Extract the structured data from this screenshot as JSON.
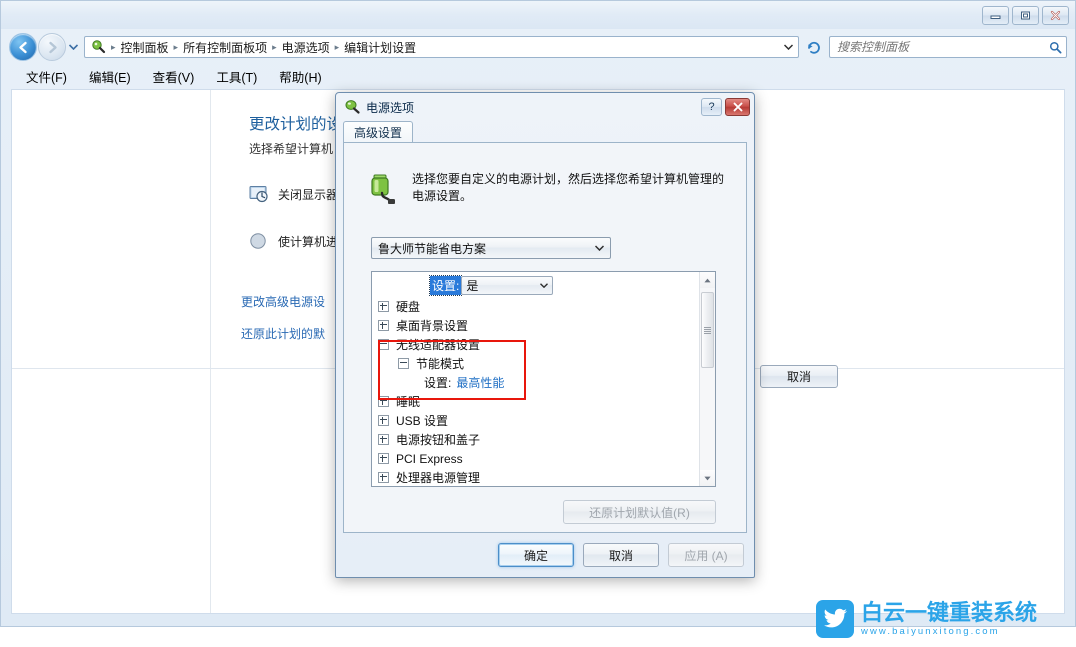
{
  "window": {
    "controls": {
      "minimize": "minimize-icon",
      "maximize": "maximize-icon",
      "close": "close-icon"
    }
  },
  "nav": {
    "back": "back-arrow-icon",
    "forward": "forward-arrow-icon",
    "history_dropdown": "chevron-down-icon",
    "refresh": "refresh-icon",
    "breadcrumb": [
      "控制面板",
      "所有控制面板项",
      "电源选项",
      "编辑计划设置"
    ],
    "breadcrumb_chevron": "chevron-down-icon"
  },
  "search": {
    "placeholder": "搜索控制面板",
    "value": "",
    "icon": "search-icon"
  },
  "menubar": {
    "items": [
      {
        "label": "文件(F)"
      },
      {
        "label": "编辑(E)"
      },
      {
        "label": "查看(V)"
      },
      {
        "label": "工具(T)"
      },
      {
        "label": "帮助(H)"
      }
    ]
  },
  "page": {
    "heading": "更改计划的设置",
    "subtitle": "选择希望计算机",
    "settings": [
      {
        "icon": "monitor-clock-icon",
        "label": "关闭显示器"
      },
      {
        "icon": "moon-sleep-icon",
        "label": "使计算机进"
      }
    ],
    "link_advanced": "更改高级电源设",
    "link_restore": "还原此计划的默",
    "cancel_button": "取消"
  },
  "dialog": {
    "title": "电源选项",
    "icon": "power-plug-icon",
    "help_button": "?",
    "close_button": "close-icon",
    "tab": "高级设置",
    "description": "选择您要自定义的电源计划，然后选择您希望计算机管理的电源设置。",
    "description_icon": "battery-plug-icon",
    "plan": {
      "selected": "鲁大师节能省电方案",
      "arrow": "chevron-down-icon"
    },
    "tree": {
      "setting_label": "设置:",
      "setting_value": "是",
      "setting_arrow": "chevron-down-icon",
      "items": [
        {
          "label": "硬盘",
          "state": "collapsed",
          "indent": 0
        },
        {
          "label": "桌面背景设置",
          "state": "collapsed",
          "indent": 0
        },
        {
          "label": "无线适配器设置",
          "state": "expanded",
          "indent": 0
        },
        {
          "label": "节能模式",
          "state": "expanded",
          "indent": 1
        },
        {
          "label": "设置:",
          "value": "最高性能",
          "state": "leaf",
          "indent": 2
        },
        {
          "label": "睡眠",
          "state": "collapsed",
          "indent": 0
        },
        {
          "label": "USB 设置",
          "state": "collapsed",
          "indent": 0
        },
        {
          "label": "电源按钮和盖子",
          "state": "collapsed",
          "indent": 0
        },
        {
          "label": "PCI Express",
          "state": "collapsed",
          "indent": 0
        },
        {
          "label": "处理器电源管理",
          "state": "collapsed",
          "indent": 0
        }
      ],
      "highlight_color": "#e8160c",
      "scrollbar": {
        "up": "scroll-up-arrow-icon",
        "down": "scroll-down-arrow-icon"
      }
    },
    "restore_defaults_button": "还原计划默认值(R)",
    "buttons": [
      {
        "label": "确定",
        "style": "default"
      },
      {
        "label": "取消",
        "style": "normal"
      },
      {
        "label": "应用 (A)",
        "style": "disabled"
      }
    ]
  },
  "watermark": {
    "title": "白云一键重装系统",
    "url": "www.baiyunxitong.com",
    "icon": "twitter-bird-icon",
    "color": "#2ba4e8"
  }
}
